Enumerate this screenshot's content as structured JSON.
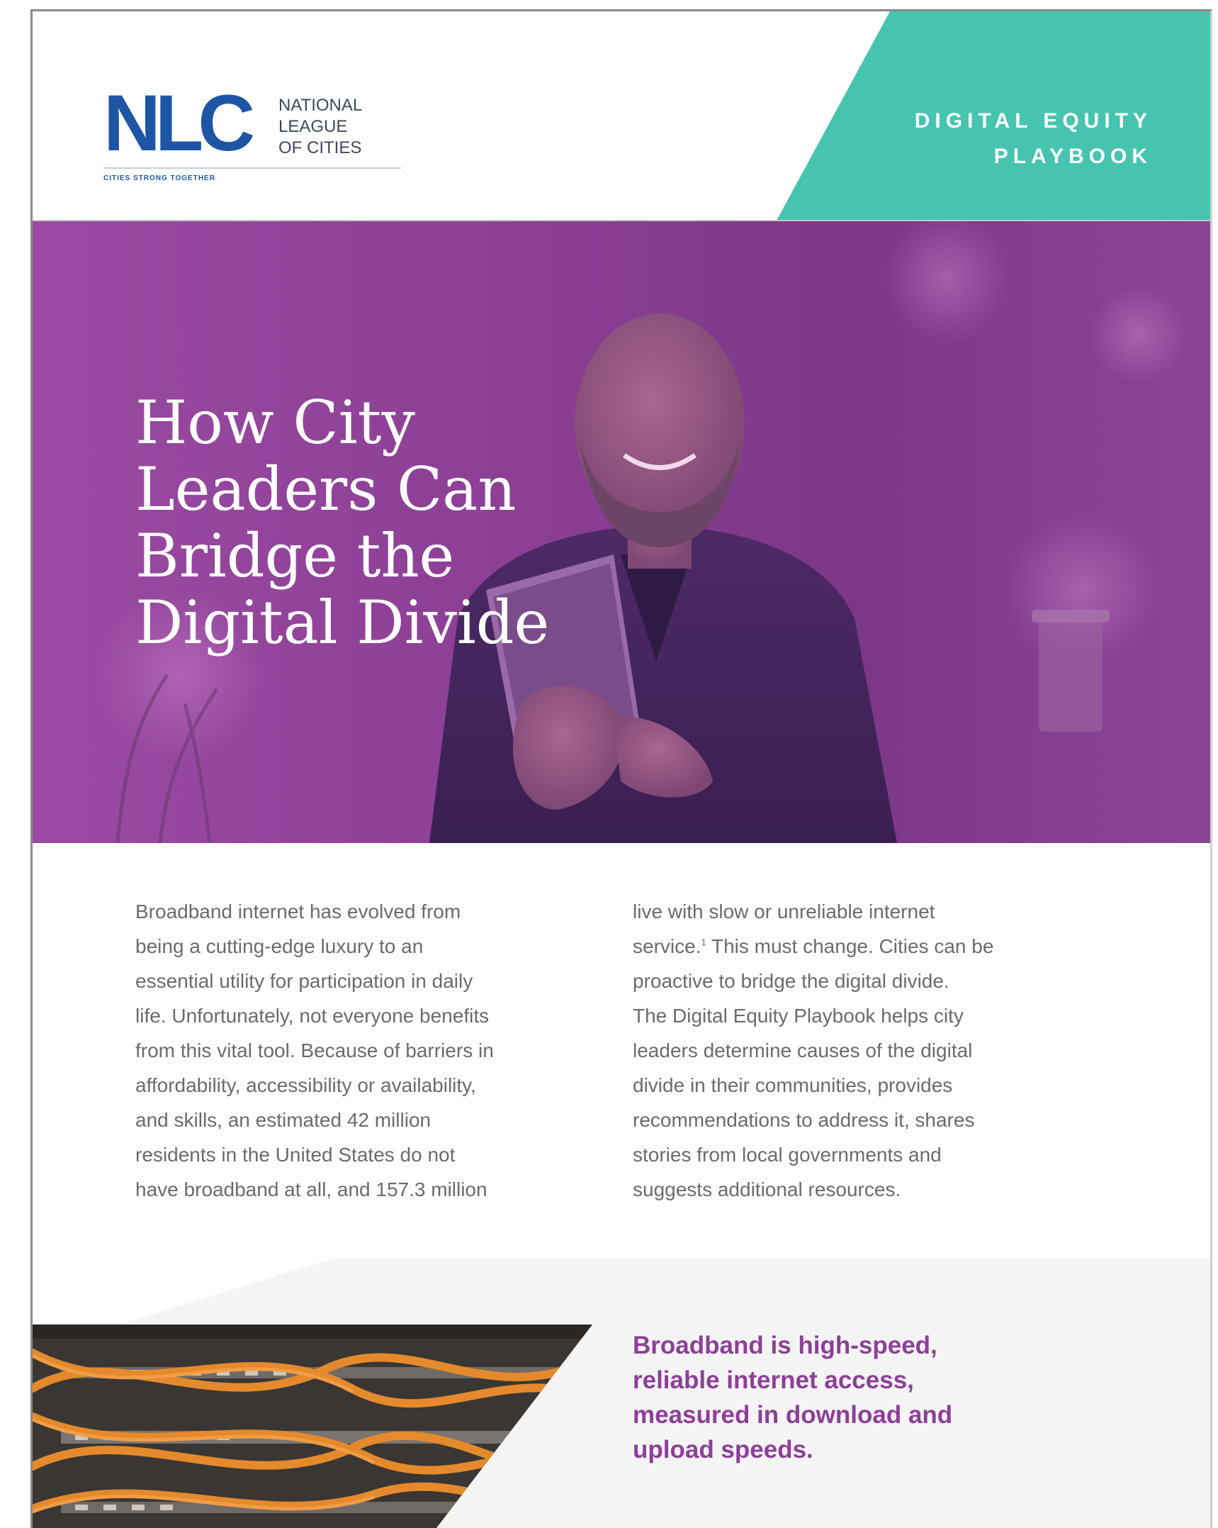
{
  "header": {
    "logo_mark": "NLC",
    "org_name_lines": [
      "NATIONAL",
      "LEAGUE",
      "OF CITIES"
    ],
    "tagline": "CITIES STRONG TOGETHER",
    "series_title_lines": [
      "DIGITAL EQUITY",
      "PLAYBOOK"
    ],
    "colors": {
      "teal": "#47c4b0",
      "brand_blue": "#1e55a5"
    }
  },
  "hero": {
    "title_lines": [
      "How City",
      "Leaders Can",
      "Bridge the",
      "Digital Divide"
    ],
    "overlay_color": "#8c3f95"
  },
  "intro": {
    "left_lines": [
      "Broadband internet has evolved from",
      "being a cutting-edge luxury to an",
      "essential utility for participation in daily",
      "life. Unfortunately, not everyone benefits",
      "from this vital tool. Because of barriers in",
      "affordability, accessibility or availability,",
      "and skills, an estimated 42 million",
      "residents in the United States do not",
      "have broadband at all, and 157.3 million"
    ],
    "right_line_1": "live with slow or unreliable internet",
    "right_line_2_before": "service.",
    "right_footnote": "1",
    "right_line_2_after": " This must change. Cities can be",
    "right_lines_rest": [
      "proactive to bridge the digital divide.",
      "The Digital Equity Playbook helps city",
      "leaders determine causes of the digital",
      "divide in their communities, provides",
      "recommendations to address it, shares",
      "stories from local governments and",
      "suggests additional resources."
    ]
  },
  "definition": {
    "lines": [
      "Broadband is high-speed,",
      "reliable internet access,",
      "measured in download and",
      "upload speeds."
    ],
    "color": "#8d3f98"
  }
}
